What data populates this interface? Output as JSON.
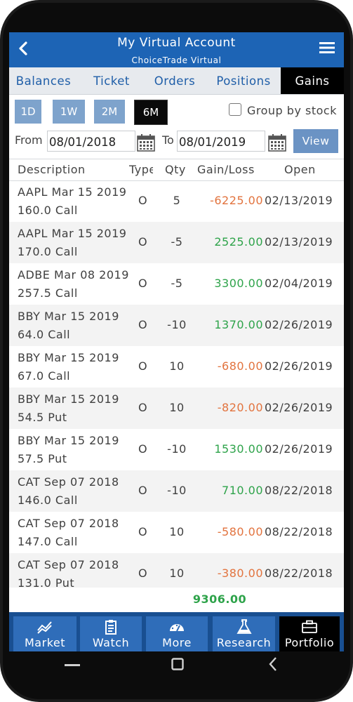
{
  "header": {
    "title": "My Virtual Account",
    "subtitle": "ChoiceTrade Virtual"
  },
  "tabs": [
    {
      "label": "Balances"
    },
    {
      "label": "Ticket"
    },
    {
      "label": "Orders"
    },
    {
      "label": "Positions"
    },
    {
      "label": "Gains",
      "active": true
    }
  ],
  "periods": [
    {
      "label": "1D"
    },
    {
      "label": "1W"
    },
    {
      "label": "2M"
    },
    {
      "label": "6M",
      "selected": true
    }
  ],
  "group_by_stock": {
    "label": "Group by stock",
    "checked": false
  },
  "date_range": {
    "from_label": "From",
    "from_value": "08/01/2018",
    "to_label": "To",
    "to_value": "08/01/2019",
    "view_label": "View"
  },
  "table": {
    "columns": [
      "Description",
      "Type",
      "Qty",
      "Gain/Loss",
      "Open"
    ],
    "rows": [
      {
        "description": "AAPL Mar 15 2019 160.0 Call",
        "type": "O",
        "qty": "5",
        "gain_loss": "-6225.00",
        "open": "02/13/2019"
      },
      {
        "description": "AAPL Mar 15 2019 170.0 Call",
        "type": "O",
        "qty": "-5",
        "gain_loss": "2525.00",
        "open": "02/13/2019"
      },
      {
        "description": "ADBE Mar 08 2019 257.5 Call",
        "type": "O",
        "qty": "-5",
        "gain_loss": "3300.00",
        "open": "02/04/2019"
      },
      {
        "description": "BBY Mar 15 2019 64.0 Call",
        "type": "O",
        "qty": "-10",
        "gain_loss": "1370.00",
        "open": "02/26/2019"
      },
      {
        "description": "BBY Mar 15 2019 67.0 Call",
        "type": "O",
        "qty": "10",
        "gain_loss": "-680.00",
        "open": "02/26/2019"
      },
      {
        "description": "BBY Mar 15 2019 54.5 Put",
        "type": "O",
        "qty": "10",
        "gain_loss": "-820.00",
        "open": "02/26/2019"
      },
      {
        "description": "BBY Mar 15 2019 57.5 Put",
        "type": "O",
        "qty": "-10",
        "gain_loss": "1530.00",
        "open": "02/26/2019"
      },
      {
        "description": "CAT Sep 07 2018 146.0 Call",
        "type": "O",
        "qty": "-10",
        "gain_loss": "710.00",
        "open": "08/22/2018"
      },
      {
        "description": "CAT Sep 07 2018 147.0 Call",
        "type": "O",
        "qty": "10",
        "gain_loss": "-580.00",
        "open": "08/22/2018"
      },
      {
        "description": "CAT Sep 07 2018 131.0 Put",
        "type": "O",
        "qty": "10",
        "gain_loss": "-380.00",
        "open": "08/22/2018"
      }
    ],
    "total": "9306.00"
  },
  "bottom_nav": [
    {
      "label": "Market",
      "icon": "chart-line-icon"
    },
    {
      "label": "Watch",
      "icon": "clipboard-icon"
    },
    {
      "label": "More",
      "icon": "gauge-icon"
    },
    {
      "label": "Research",
      "icon": "flask-icon"
    },
    {
      "label": "Portfolio",
      "icon": "briefcase-icon",
      "active": true
    }
  ],
  "colors": {
    "header": "#1d64b5",
    "tab_text": "#1f5ea8",
    "negative": "#e2733e",
    "positive": "#2ea34a",
    "nav": "#2f6db9",
    "active": "#000000"
  }
}
